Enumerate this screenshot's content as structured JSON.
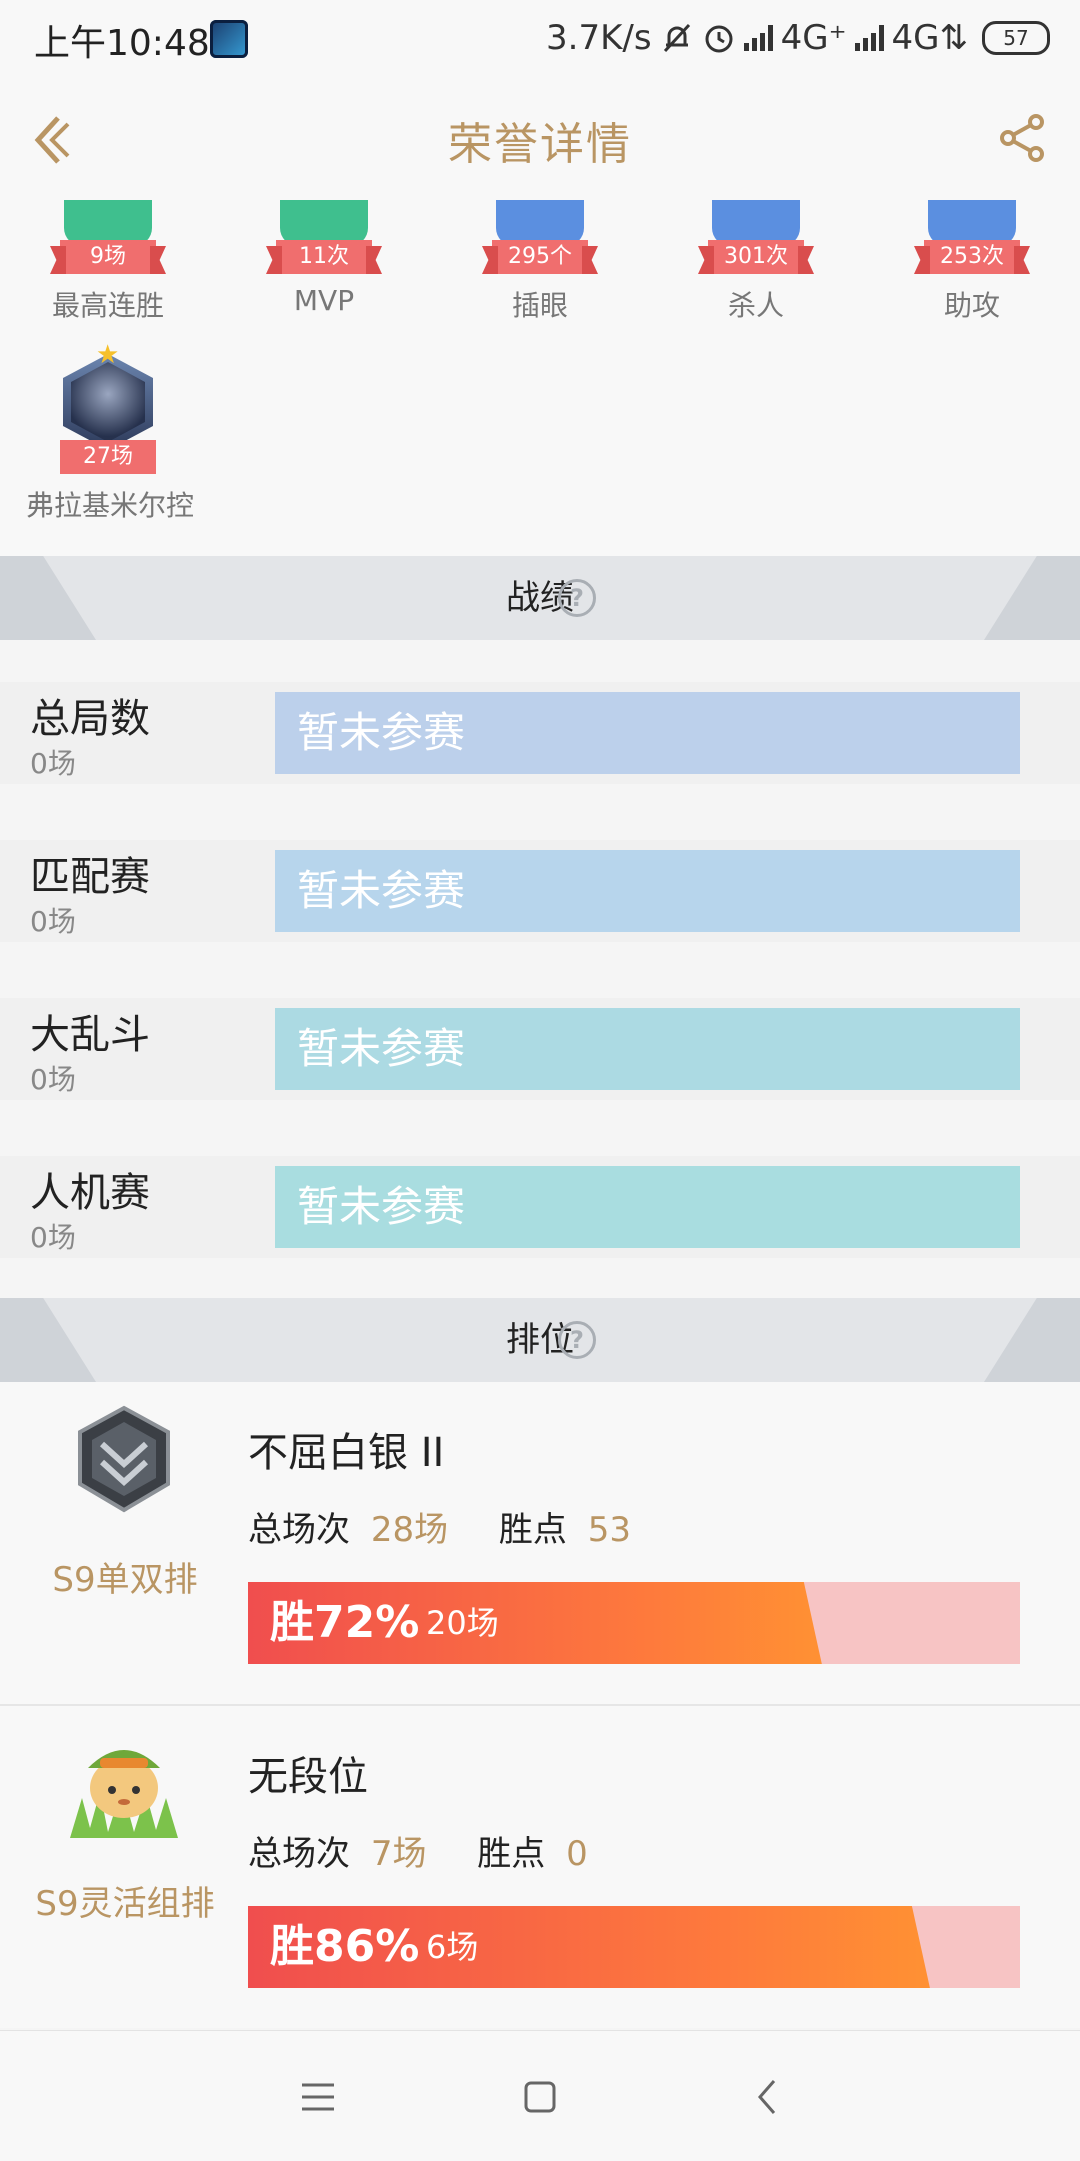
{
  "status_bar": {
    "time": "上午10:48",
    "speed": "3.7K/s",
    "net1": "4G⁺",
    "net2": "4G⇅",
    "battery": "57"
  },
  "header": {
    "title": "荣誉详情"
  },
  "badges": [
    {
      "value": "9场",
      "label": "最高连胜",
      "color": "#3fbf8e"
    },
    {
      "value": "11次",
      "label": "MVP",
      "color": "#3fbf8e"
    },
    {
      "value": "295个",
      "label": "插眼",
      "color": "#5b8fe0"
    },
    {
      "value": "301次",
      "label": "杀人",
      "color": "#5b8fe0"
    },
    {
      "value": "253次",
      "label": "助攻",
      "color": "#5b8fe0"
    }
  ],
  "champion_badge": {
    "value": "27场",
    "label": "弗拉基米尔控"
  },
  "record_section": {
    "title": "战绩"
  },
  "records": [
    {
      "name": "总局数",
      "count": "0场",
      "status": "暂未参赛",
      "color": "#bcd0eb"
    },
    {
      "name": "匹配赛",
      "count": "0场",
      "status": "暂未参赛",
      "color": "#b7d5ec"
    },
    {
      "name": "大乱斗",
      "count": "0场",
      "status": "暂未参赛",
      "color": "#acdae3"
    },
    {
      "name": "人机赛",
      "count": "0场",
      "status": "暂未参赛",
      "color": "#a9dde0"
    }
  ],
  "rank_section": {
    "title": "排位"
  },
  "ranks": [
    {
      "queue": "S9单双排",
      "tier": "不屈白银 II",
      "games_label": "总场次",
      "games": "28场",
      "points_label": "胜点",
      "points": "53",
      "win_rate_text": "胜72%",
      "wins": "20场",
      "win_rate": 0.72
    },
    {
      "queue": "S9灵活组排",
      "tier": "无段位",
      "games_label": "总场次",
      "games": "7场",
      "points_label": "胜点",
      "points": "0",
      "win_rate_text": "胜86%",
      "wins": "6场",
      "win_rate": 0.86
    }
  ],
  "icons": {
    "back": "back-chevron-icon",
    "share": "share-icon",
    "help": "question-circle-icon",
    "menu": "menu-icon",
    "home": "home-square-icon",
    "nav_back": "nav-back-icon"
  },
  "colors": {
    "accent": "#b99563",
    "win_bar": "#f04e4e",
    "loss_bar": "#f7c4c4"
  }
}
